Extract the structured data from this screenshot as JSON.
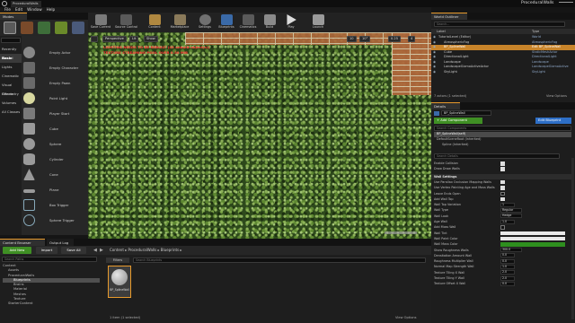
{
  "window": {
    "project_tab": "ProceduralWalls"
  },
  "menu": [
    "File",
    "Edit",
    "Window",
    "Help"
  ],
  "tabs": {
    "modes": "Modes",
    "viewport": "Viewport 1",
    "content_browser": "Content Browser",
    "output_log": "Output Log",
    "world_outliner": "World Outliner",
    "details": "Details"
  },
  "toolbar": [
    "Save Current",
    "Source Control",
    "Content",
    "Marketplace",
    "Settings",
    "Blueprints",
    "Cinematics",
    "Build",
    "Play",
    "Launch"
  ],
  "place": {
    "categories": [
      "Recently Placed",
      "Basic",
      "Lights",
      "Cinematic",
      "Visual Effects",
      "Geometry",
      "Volumes",
      "All Classes"
    ],
    "selected": "Basic",
    "items": [
      "Empty Actor",
      "Empty Character",
      "Empty Pawn",
      "Point Light",
      "Player Start",
      "Cube",
      "Sphere",
      "Cylinder",
      "Cone",
      "Plane",
      "Box Trigger",
      "Sphere Trigger"
    ]
  },
  "viewport": {
    "buttons": [
      "Perspective",
      "Lit",
      "Show"
    ],
    "grid": "10",
    "rotation": "10°",
    "scale": "0.25",
    "camera_speed": "4",
    "warnings": [
      "LIGHTING NEEDS TO BE REBUILT (43 unbuilt object(s))",
      "TEXTURE STREAMING POOL OVER 0.50 MiB"
    ]
  },
  "content_browser": {
    "add_new": "Add New",
    "import": "Import",
    "save_all": "Save All",
    "path": [
      "Content",
      "ProceduralWalls",
      "Blueprints"
    ],
    "search_placeholder": "Search Paths",
    "filters": "Filters",
    "search_assets": "Search Blueprints",
    "tree": [
      "Content",
      "Assets",
      "ProceduralWalls",
      "Blueprints",
      "Brains",
      "Material",
      "Meshes",
      "Texture",
      "StarterContent"
    ],
    "tree_selected": "Blueprints",
    "asset": "BP_SplineWall",
    "status": "1 item (1 selected)",
    "view_options": "View Options"
  },
  "outliner": {
    "search": "Search...",
    "headers": [
      "Label",
      "Type"
    ],
    "rows": [
      {
        "label": "TutorialLevel (Editor)",
        "type": "World"
      },
      {
        "label": "AtmosphericFog",
        "type": "AtmosphericFog"
      },
      {
        "label": "BP_SplineWall",
        "type": "Edit BP_SplineWall"
      },
      {
        "label": "Cube",
        "type": "StaticMeshActor"
      },
      {
        "label": "DirectionalLight",
        "type": "DirectionalLight"
      },
      {
        "label": "Landscape",
        "type": "Landscape"
      },
      {
        "label": "LandscapeGizmoActiveActor",
        "type": "LandscapeGizmoActive"
      },
      {
        "label": "SkyLight",
        "type": "SkyLight"
      }
    ],
    "selected_index": 2,
    "status": "7 actors (1 selected)",
    "view_options": "View Options"
  },
  "details": {
    "name": "BP_SplineWall",
    "add_component": "+ Add Component",
    "edit_blueprint": "Edit Blueprint",
    "search_components": "Search Components",
    "components": [
      "BP_SplineWall(self)",
      "DefaultSceneRoot (Inherited)",
      "Spline (Inherited)"
    ],
    "search_details": "Search Details",
    "props_top": [
      {
        "label": "Enable Collision",
        "checked": true
      },
      {
        "label": "Draw Draw Walls",
        "checked": true
      }
    ],
    "section": "Wall Settings",
    "props": [
      {
        "label": "Use Parallax Occlusion Mapping Walls",
        "kind": "check",
        "checked": true
      },
      {
        "label": "Use Vertex Painting Age and Moss Walls",
        "kind": "check",
        "checked": true
      },
      {
        "label": "Leave Ends Open",
        "kind": "check",
        "checked": false
      },
      {
        "label": "Add Wall Top",
        "kind": "check",
        "checked": true
      },
      {
        "label": "Wall Top Variation",
        "kind": "value",
        "value": "1"
      },
      {
        "label": "Wall Type",
        "kind": "value",
        "value": "Regular"
      },
      {
        "label": "Wall Look",
        "kind": "value",
        "value": "Hedge"
      },
      {
        "label": "Age Wall",
        "kind": "value",
        "value": "1.0"
      },
      {
        "label": "Add Moss Wall",
        "kind": "check",
        "checked": false
      },
      {
        "label": "Wall Tint",
        "kind": "color",
        "value": "#e8e8e8"
      },
      {
        "label": "Wall Paint Color",
        "kind": "color",
        "value": "#e8e8e8"
      },
      {
        "label": "Wall Moss Color",
        "kind": "color",
        "value": "#2e8f1e"
      },
      {
        "label": "Show Roughness Walls",
        "kind": "value",
        "value": "300.0"
      },
      {
        "label": "Densitation Amount Wall",
        "kind": "value",
        "value": "0.0"
      },
      {
        "label": "Roughness Multiplier Wall",
        "kind": "value",
        "value": "0.0"
      },
      {
        "label": "Normal Map Strength Wall",
        "kind": "value",
        "value": "1.0"
      },
      {
        "label": "Texture Tiling X Wall",
        "kind": "value",
        "value": "2.0"
      },
      {
        "label": "Texture Tiling Y Wall",
        "kind": "value",
        "value": "2.0"
      },
      {
        "label": "Texture Offset X Wall",
        "kind": "value",
        "value": "0.0"
      }
    ]
  }
}
